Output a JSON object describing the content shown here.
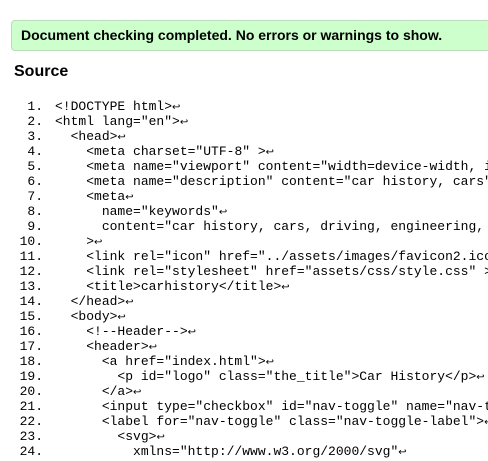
{
  "banner": {
    "message": "Document checking completed. No errors or warnings to show."
  },
  "source": {
    "heading": "Source",
    "line_break_glyph": "↩",
    "lines": [
      {
        "number": "1.",
        "indent": "",
        "code": "<!DOCTYPE html>"
      },
      {
        "number": "2.",
        "indent": "",
        "code": "<html lang=\"en\">"
      },
      {
        "number": "3.",
        "indent": "  ",
        "code": "<head>"
      },
      {
        "number": "4.",
        "indent": "    ",
        "code": "<meta charset=\"UTF-8\" >"
      },
      {
        "number": "5.",
        "indent": "    ",
        "code": "<meta name=\"viewport\" content=\"width=device-width, in"
      },
      {
        "number": "6.",
        "indent": "    ",
        "code": "<meta name=\"description\" content=\"car history, cars\""
      },
      {
        "number": "7.",
        "indent": "    ",
        "code": "<meta"
      },
      {
        "number": "8.",
        "indent": "      ",
        "code": "name=\"keywords\""
      },
      {
        "number": "9.",
        "indent": "      ",
        "code": "content=\"car history, cars, driving, engineering, a"
      },
      {
        "number": "10.",
        "indent": "    ",
        "code": ">"
      },
      {
        "number": "11.",
        "indent": "    ",
        "code": "<link rel=\"icon\" href=\"../assets/images/favicon2.ico\""
      },
      {
        "number": "12.",
        "indent": "    ",
        "code": "<link rel=\"stylesheet\" href=\"assets/css/style.css\" >"
      },
      {
        "number": "13.",
        "indent": "    ",
        "code": "<title>carhistory</title>"
      },
      {
        "number": "14.",
        "indent": "  ",
        "code": "</head>"
      },
      {
        "number": "15.",
        "indent": "  ",
        "code": "<body>"
      },
      {
        "number": "16.",
        "indent": "    ",
        "code": "<!--Header-->"
      },
      {
        "number": "17.",
        "indent": "    ",
        "code": "<header>"
      },
      {
        "number": "18.",
        "indent": "      ",
        "code": "<a href=\"index.html\">"
      },
      {
        "number": "19.",
        "indent": "        ",
        "code": "<p id=\"logo\" class=\"the_title\">Car History</p>"
      },
      {
        "number": "20.",
        "indent": "      ",
        "code": "</a>"
      },
      {
        "number": "21.",
        "indent": "      ",
        "code": "<input type=\"checkbox\" id=\"nav-toggle\" name=\"nav-to"
      },
      {
        "number": "22.",
        "indent": "      ",
        "code": "<label for=\"nav-toggle\" class=\"nav-toggle-label\">"
      },
      {
        "number": "23.",
        "indent": "        ",
        "code": "<svg>"
      },
      {
        "number": "24.",
        "indent": "          ",
        "code": "xmlns=\"http://www.w3.org/2000/svg\""
      }
    ]
  }
}
